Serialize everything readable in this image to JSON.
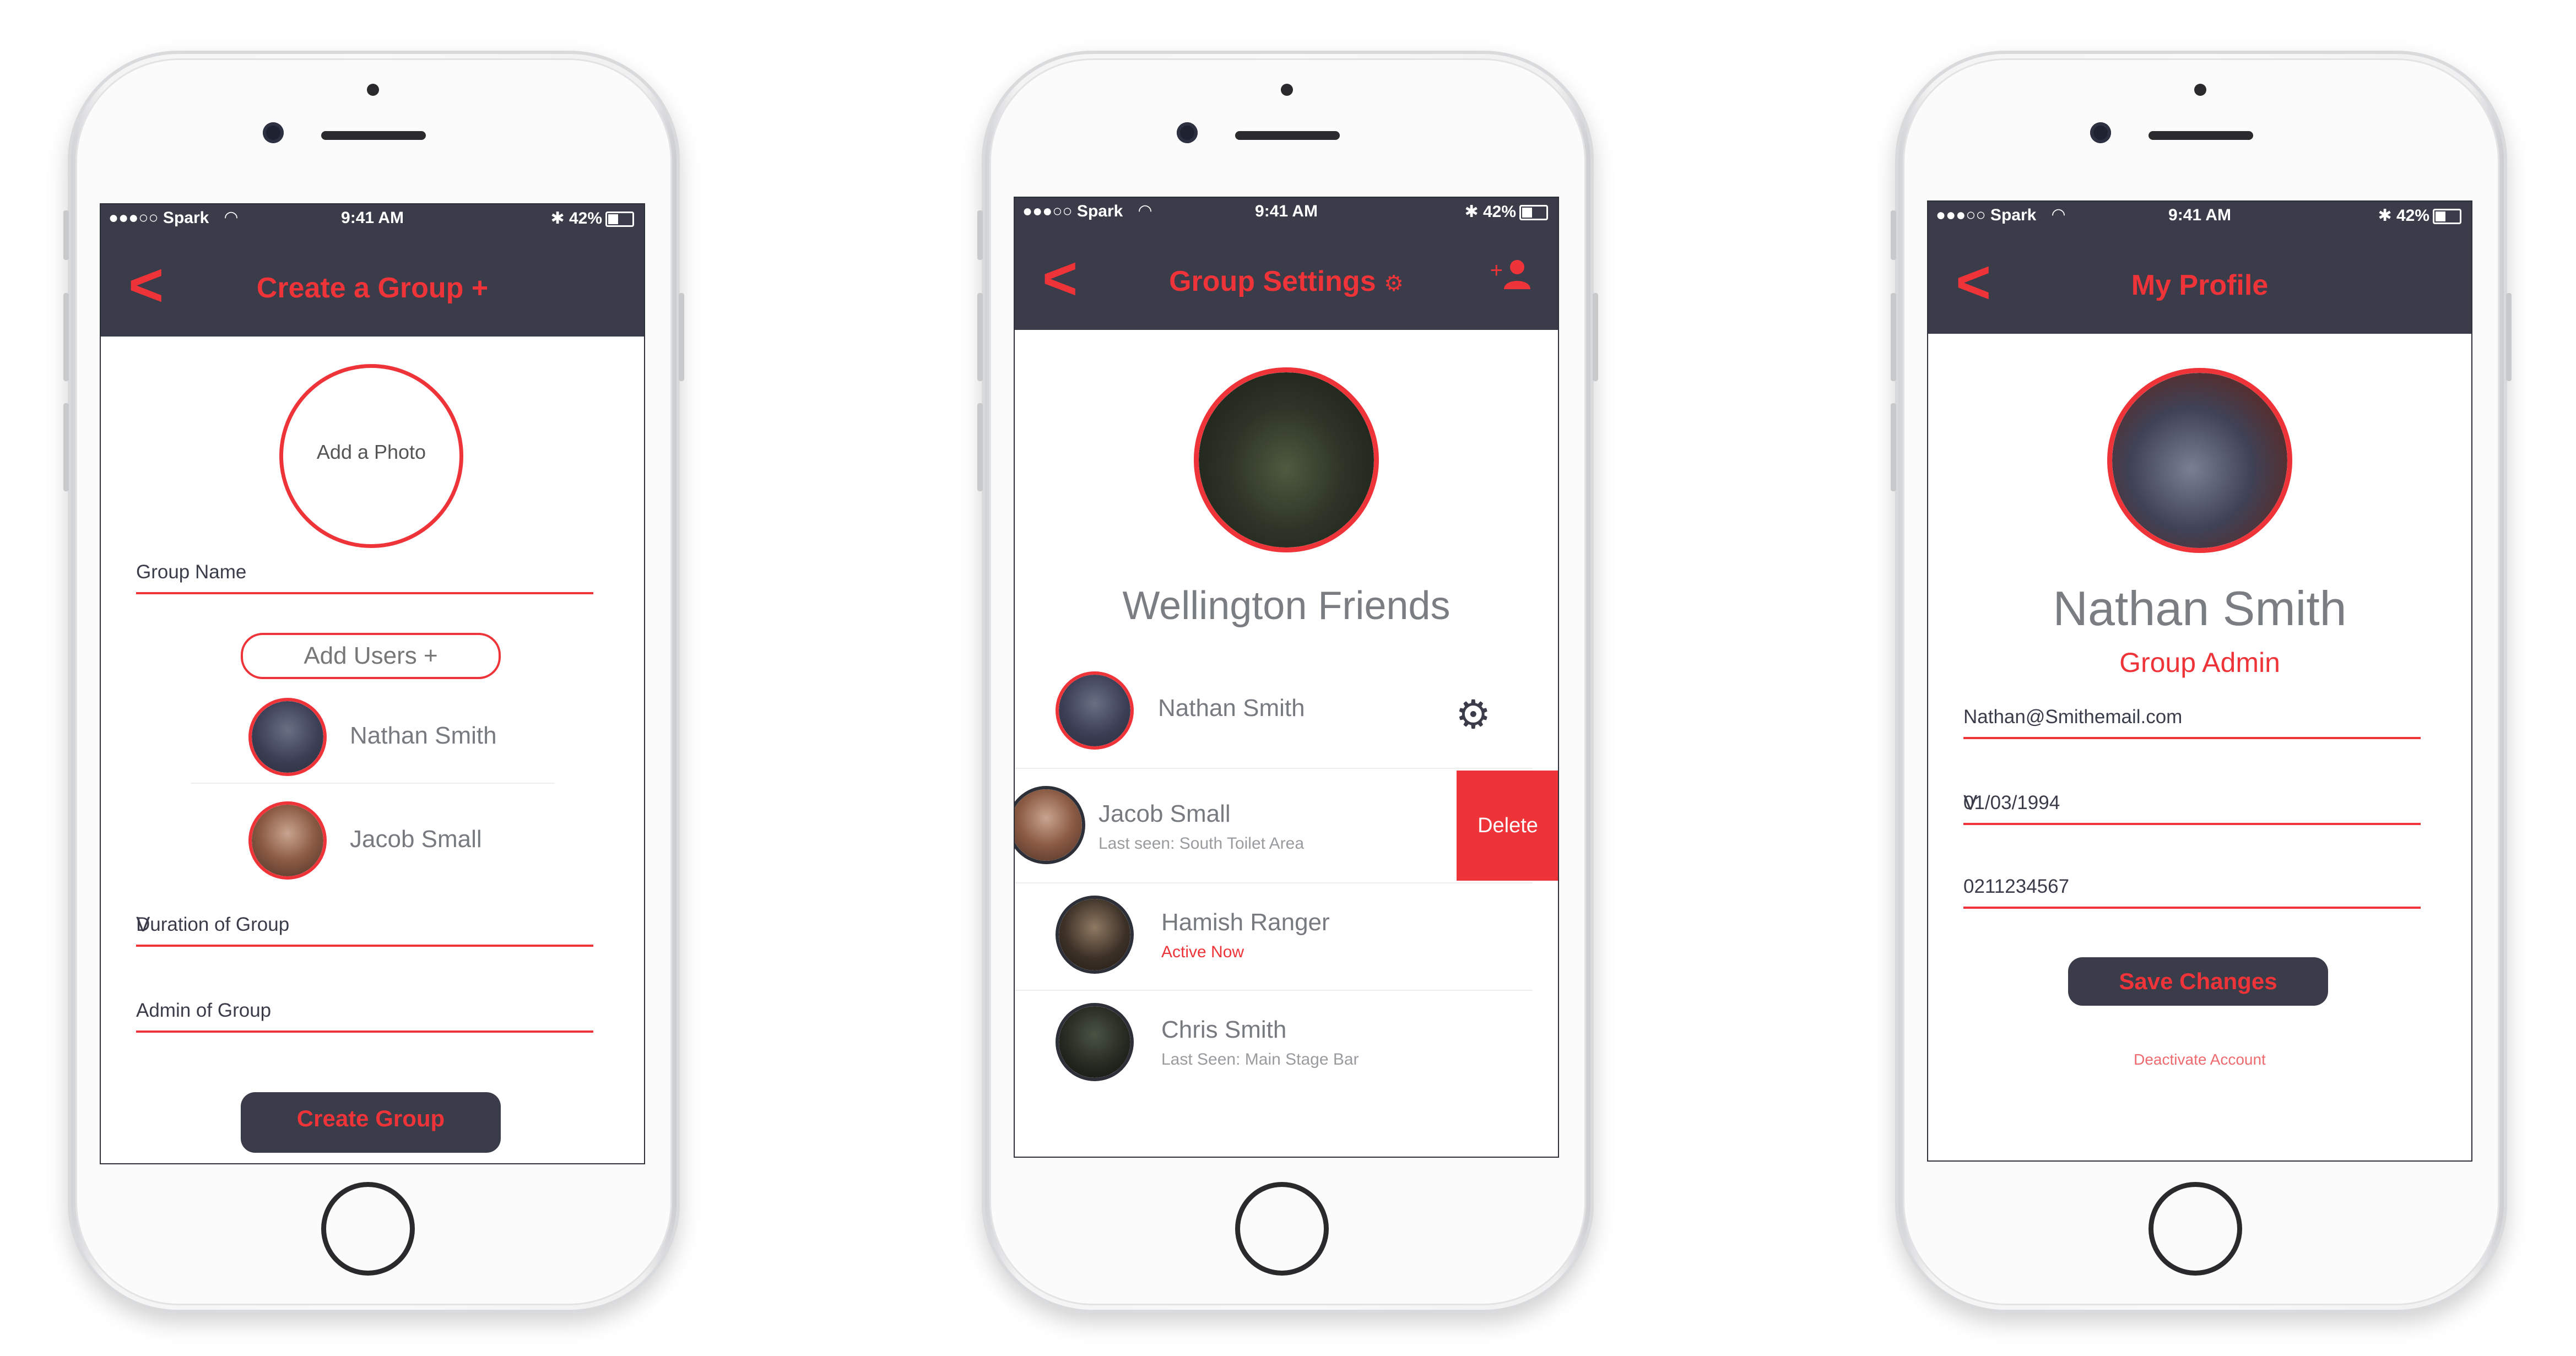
{
  "status_bar": {
    "carrier": "●●●○○ Spark",
    "wifi": "wifi-icon",
    "time": "9:41 AM",
    "battery": "42%"
  },
  "screen1": {
    "back": "<",
    "title": "Create a Group +",
    "add_photo": "Add a Photo",
    "group_name_label": "Group Name",
    "add_users_label": "Add Users +",
    "users": [
      {
        "name": "Nathan Smith"
      },
      {
        "name": "Jacob Small"
      }
    ],
    "duration_label": "Duration of Group",
    "duration_chevron": "V",
    "admin_label": "Admin of Group",
    "create_button": "Create Group"
  },
  "screen2": {
    "back": "<",
    "title": "Group Settings",
    "title_icon": "gear-icon",
    "add_member_icon": "add-user-icon",
    "add_member_label": "+",
    "group_name": "Wellington Friends",
    "members": [
      {
        "name": "Nathan Smith",
        "status": ""
      },
      {
        "name": "Jacob Small",
        "status": "Last seen: South Toilet Area"
      },
      {
        "name": "Hamish Ranger",
        "status": "Active Now"
      },
      {
        "name": "Chris Smith",
        "status": "Last Seen: Main Stage Bar"
      }
    ],
    "delete_label": "Delete"
  },
  "screen3": {
    "back": "<",
    "title": "My Profile",
    "name": "Nathan Smith",
    "role": "Group Admin",
    "email": "Nathan@Smithemail.com",
    "dob": "01/03/1994",
    "dob_chevron": "V",
    "phone": "0211234567",
    "save_button": "Save Changes",
    "deactivate_link": "Deactivate Account"
  },
  "colors": {
    "accent": "#ee3339",
    "dark": "#3a3d49",
    "text": "#777b80"
  }
}
